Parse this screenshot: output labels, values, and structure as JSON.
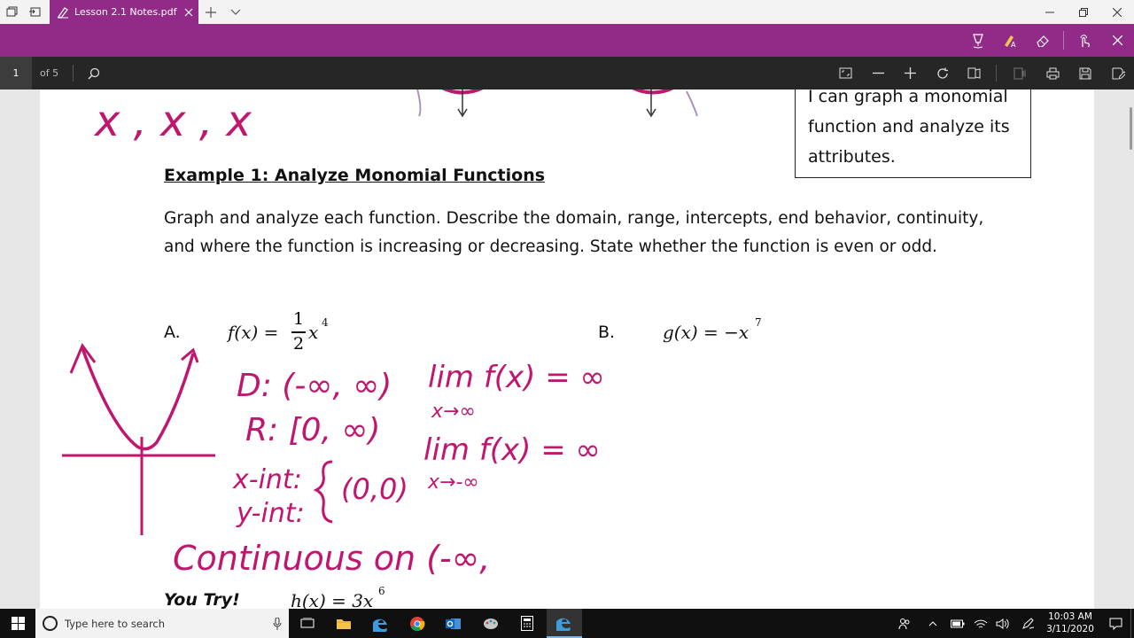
{
  "browser": {
    "tab_title": "Lesson 2.1 Notes.pdf",
    "accent_color": "#922b87"
  },
  "pdf_toolbar": {
    "page_number": "1",
    "page_count": "of 5"
  },
  "document": {
    "goal_text": "I can graph a monomial function and analyze its attributes.",
    "example_title": "Example 1: Analyze Monomial Functions",
    "instructions": "Graph and analyze each function. Describe the domain, range, intercepts, end behavior, continuity, and where the function is increasing or decreasing. State whether the function is even or odd.",
    "part_a": {
      "label": "A.",
      "function_name": "f(x) =",
      "numerator": "1",
      "denominator": "2",
      "variable": "x",
      "exponent": "4"
    },
    "part_b": {
      "label": "B.",
      "function": "g(x) = −x",
      "exponent": "7"
    },
    "you_try": {
      "label": "You Try!",
      "function": "h(x) = 3x",
      "exponent": "6"
    },
    "top_scribble": "x , x , x"
  },
  "handwriting": {
    "ink_color": "#c0166e",
    "domain": "D: (-∞, ∞)",
    "range": "R: [0, ∞)",
    "x_int": "x-int:",
    "y_int": "y-int:",
    "intercept_point": "(0,0)",
    "continuity": "Continuous on (-∞,",
    "limit_pos": "lim f(x) = ∞",
    "limit_pos_sub": "x→∞",
    "limit_neg": "lim f(x) = ∞",
    "limit_neg_sub": "x→-∞"
  },
  "taskbar": {
    "search_placeholder": "Type here to search",
    "time": "10:03 AM",
    "date": "3/11/2020"
  }
}
